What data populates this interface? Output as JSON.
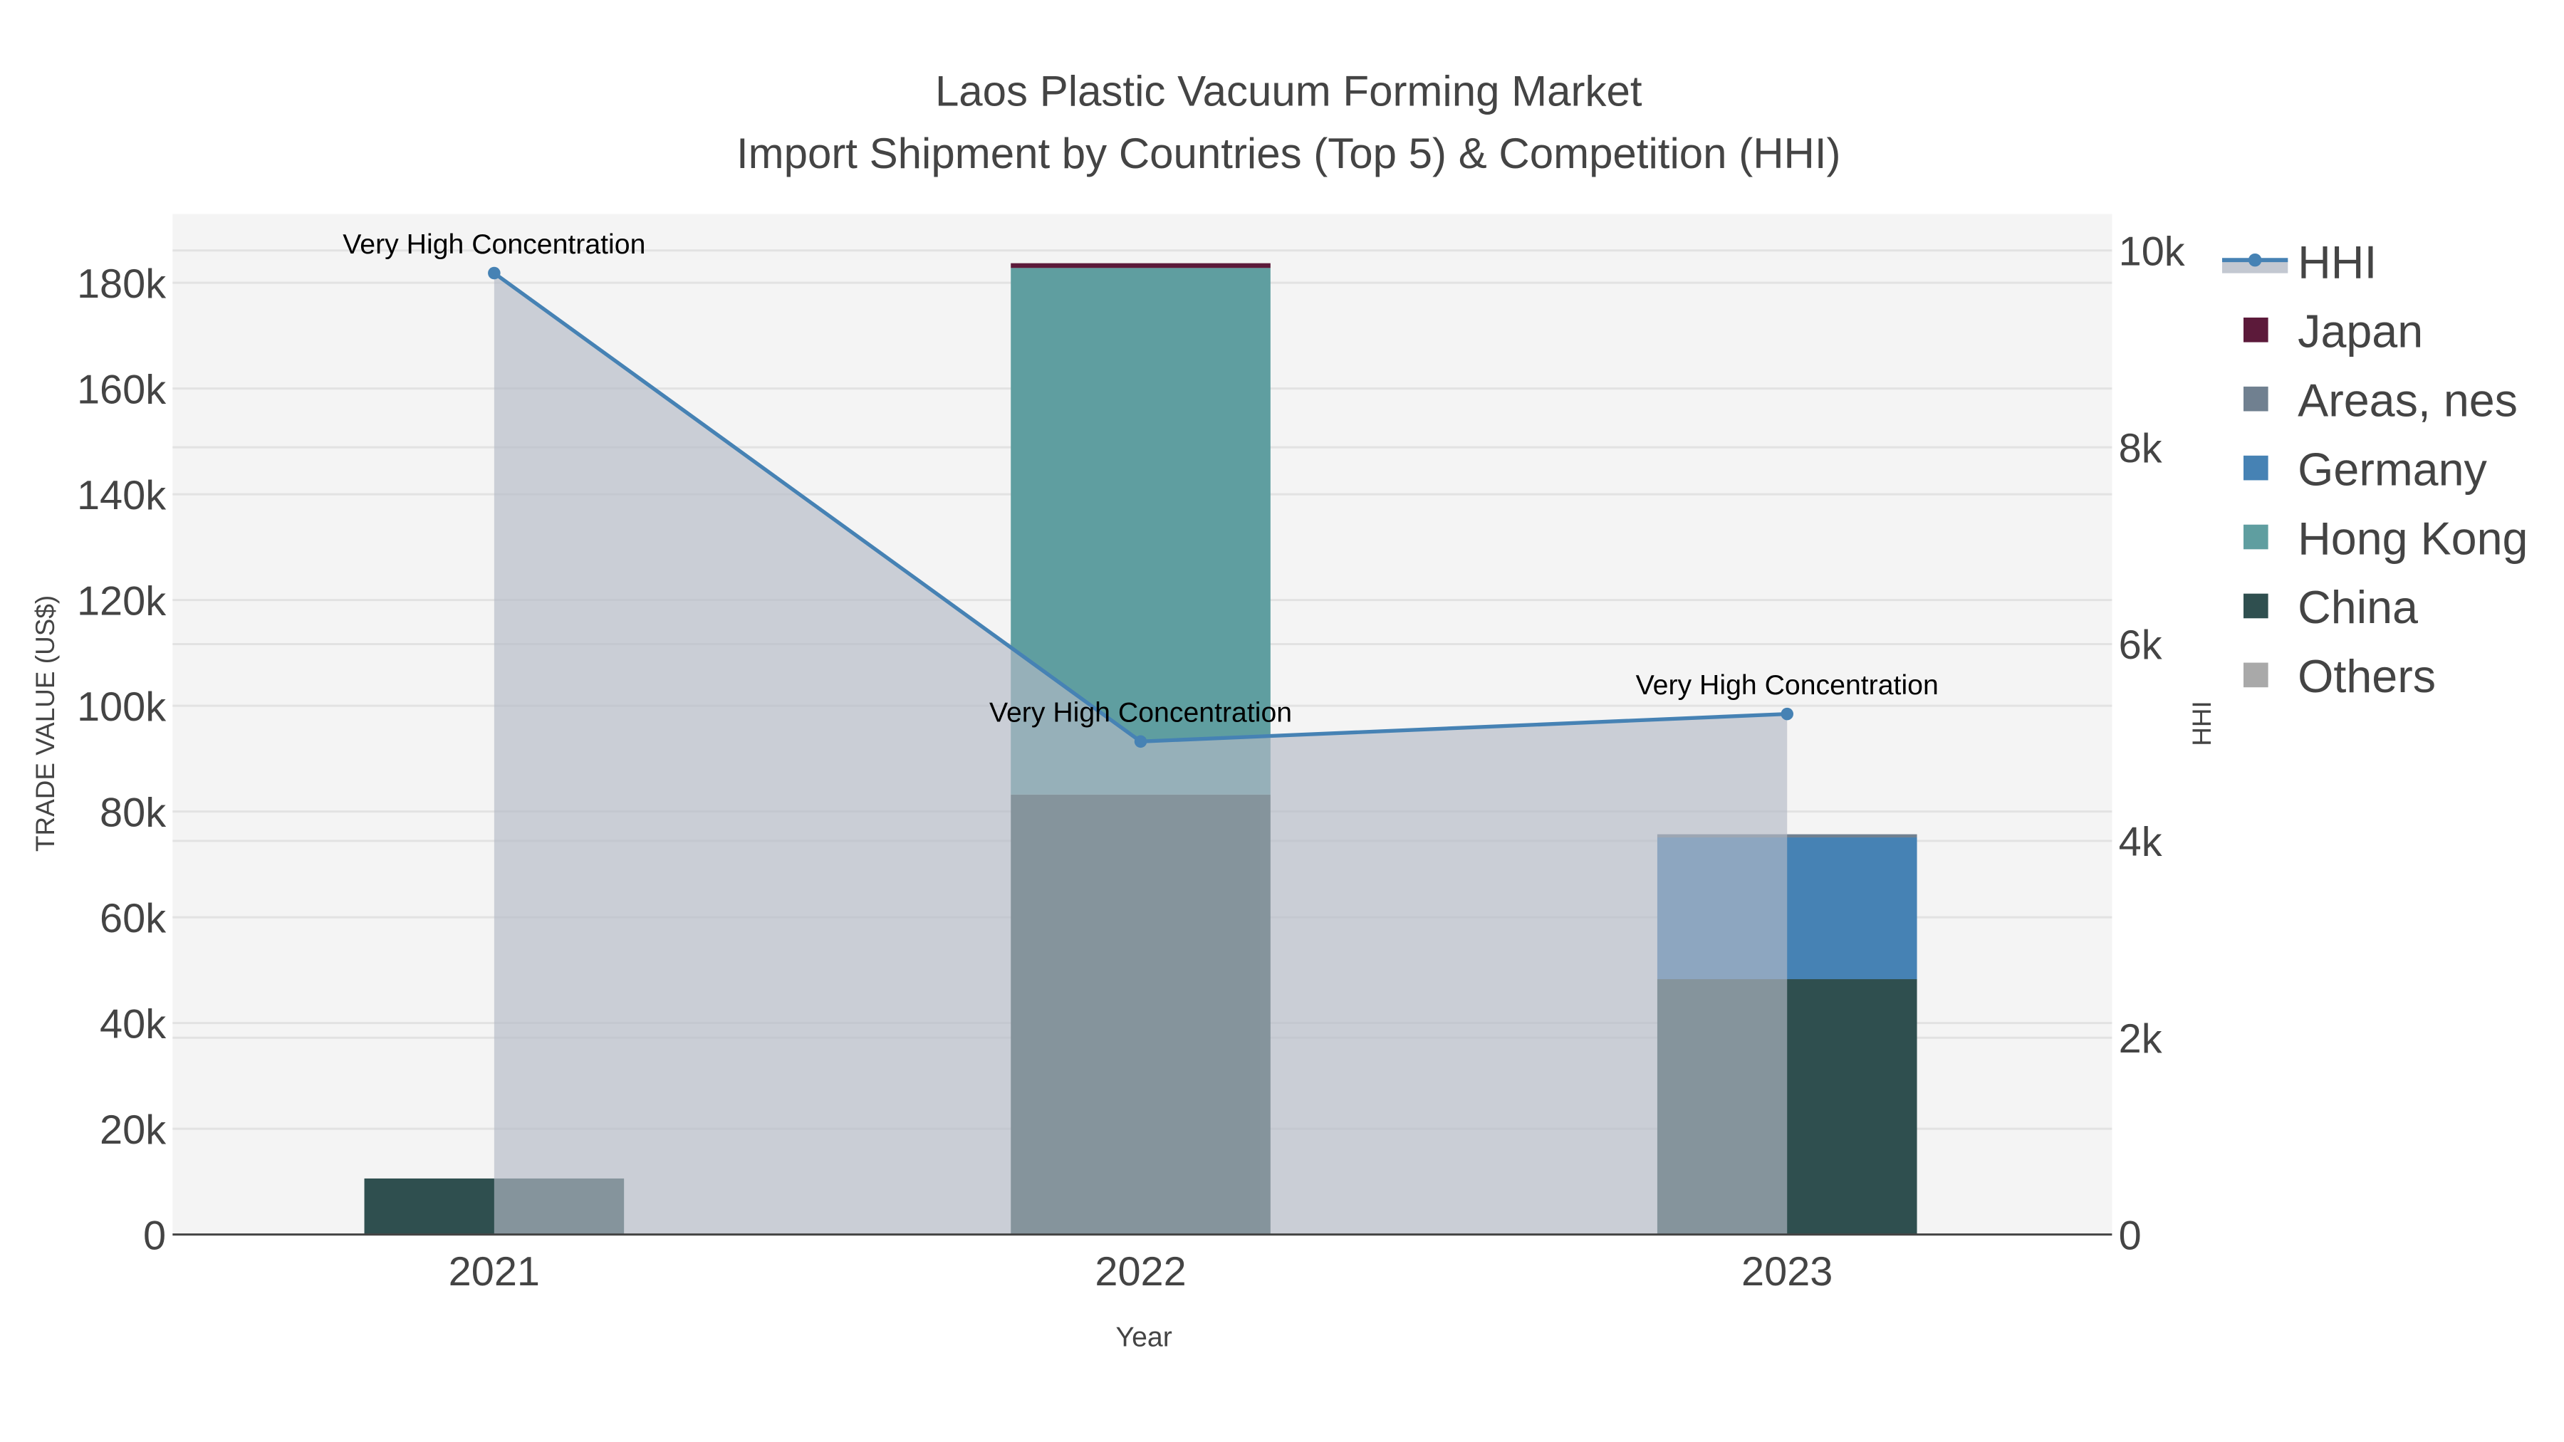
{
  "chart_data": {
    "type": "bar",
    "title": "Laos Plastic Vacuum Forming Market",
    "subtitle": "Import Shipment by Countries (Top 5) & Competition (HHI)",
    "xlabel": "Year",
    "ylabel": "TRADE VALUE (US$)",
    "y2label": "HHI",
    "categories": [
      "2021",
      "2022",
      "2023"
    ],
    "ylim": [
      0,
      193000
    ],
    "y2lim": [
      0,
      10370
    ],
    "yticks": [
      0,
      20000,
      40000,
      60000,
      80000,
      100000,
      120000,
      140000,
      160000,
      180000
    ],
    "ytick_labels": [
      "0",
      "20k",
      "40k",
      "60k",
      "80k",
      "100k",
      "120k",
      "140k",
      "160k",
      "180k"
    ],
    "y2ticks": [
      0,
      2000,
      4000,
      6000,
      8000,
      10000
    ],
    "y2tick_labels": [
      "0",
      "2k",
      "4k",
      "6k",
      "8k",
      "10k"
    ],
    "grid": true,
    "legend_position": "right",
    "series": [
      {
        "name": "Others",
        "color": "#a9a9a9",
        "values": [
          0,
          0,
          0
        ]
      },
      {
        "name": "China",
        "color": "#2f4f4f",
        "values": [
          10600,
          83200,
          48300
        ]
      },
      {
        "name": "Hong Kong",
        "color": "#5f9ea0",
        "values": [
          0,
          99600,
          0
        ]
      },
      {
        "name": "Germany",
        "color": "#4682b4",
        "values": [
          0,
          0,
          26800
        ]
      },
      {
        "name": "Areas, nes",
        "color": "#708090",
        "values": [
          0,
          0,
          600
        ]
      },
      {
        "name": "Japan",
        "color": "#5c1a3a",
        "values": [
          0,
          900,
          0
        ]
      }
    ],
    "hhi": {
      "name": "HHI",
      "color": "#4682b4",
      "values": [
        9770,
        5010,
        5290
      ],
      "annotations": [
        "Very High Concentration",
        "Very High Concentration",
        "Very High Concentration"
      ]
    },
    "legend_order": [
      "HHI",
      "Japan",
      "Areas, nes",
      "Germany",
      "Hong Kong",
      "China",
      "Others"
    ]
  }
}
